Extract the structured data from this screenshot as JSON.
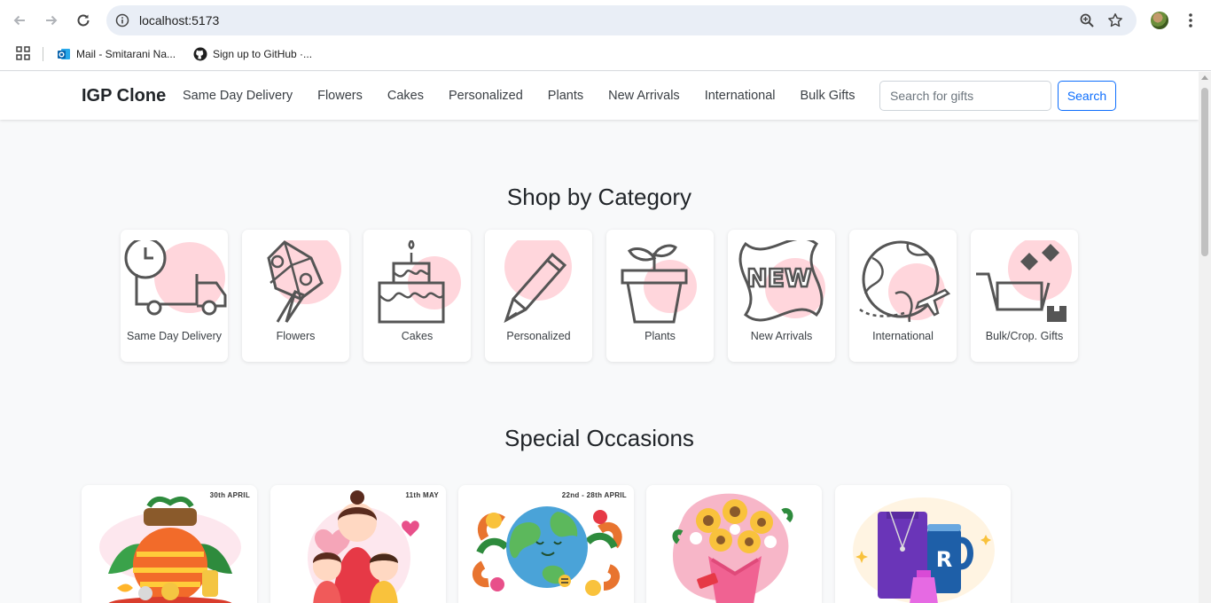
{
  "browser": {
    "url": "localhost:5173",
    "bookmarks": [
      {
        "label": "Mail - Smitarani Na...",
        "icon": "outlook-icon"
      },
      {
        "label": "Sign up to GitHub ·...",
        "icon": "github-icon"
      }
    ]
  },
  "navbar": {
    "brand": "IGP Clone",
    "links": [
      "Same Day Delivery",
      "Flowers",
      "Cakes",
      "Personalized",
      "Plants",
      "New Arrivals",
      "International",
      "Bulk Gifts"
    ],
    "search_placeholder": "Search for gifts",
    "search_button": "Search"
  },
  "categories": {
    "title": "Shop by Category",
    "items": [
      {
        "label": "Same Day Delivery",
        "icon": "delivery-truck-icon"
      },
      {
        "label": "Flowers",
        "icon": "bouquet-icon"
      },
      {
        "label": "Cakes",
        "icon": "cake-icon"
      },
      {
        "label": "Personalized",
        "icon": "pencil-icon"
      },
      {
        "label": "Plants",
        "icon": "plant-pot-icon"
      },
      {
        "label": "New Arrivals",
        "icon": "new-badge-icon"
      },
      {
        "label": "International",
        "icon": "globe-plane-icon"
      },
      {
        "label": "Bulk/Crop. Gifts",
        "icon": "gift-cart-icon"
      }
    ],
    "accent_color": "#ffd6dc"
  },
  "occasions": {
    "title": "Special Occasions",
    "items": [
      {
        "date": "30th APRIL",
        "image": "akshaya-tritiya-kalash"
      },
      {
        "date": "11th MAY",
        "image": "mothers-day"
      },
      {
        "date": "22nd - 28th APRIL",
        "image": "earth-day-globe"
      },
      {
        "date": "",
        "image": "sunflower-bouquet"
      },
      {
        "date": "",
        "image": "gift-bag-mug"
      }
    ]
  }
}
